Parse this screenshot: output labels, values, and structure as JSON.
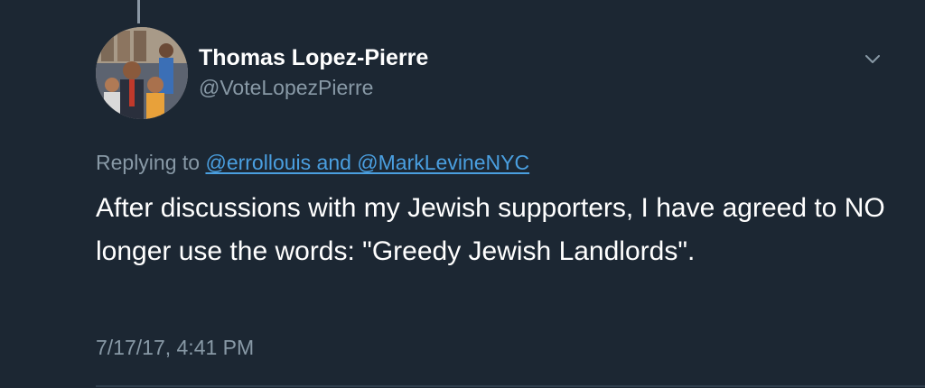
{
  "tweet": {
    "author_name": "Thomas Lopez-Pierre",
    "author_handle": "@VoteLopezPierre",
    "reply_prefix": "Replying to",
    "reply_mentions": "@errollouis and @MarkLevineNYC",
    "body": "After discussions with my Jewish supporters, I have agreed to NO longer use the words: \"Greedy Jewish Landlords\".",
    "timestamp": "7/17/17, 4:41 PM"
  },
  "icons": {
    "menu": "chevron-down-icon",
    "avatar": "profile-photo"
  },
  "colors": {
    "background": "#1c2733",
    "primary_text": "#ffffff",
    "secondary_text": "#8899a6",
    "link": "#4a9fe0"
  }
}
